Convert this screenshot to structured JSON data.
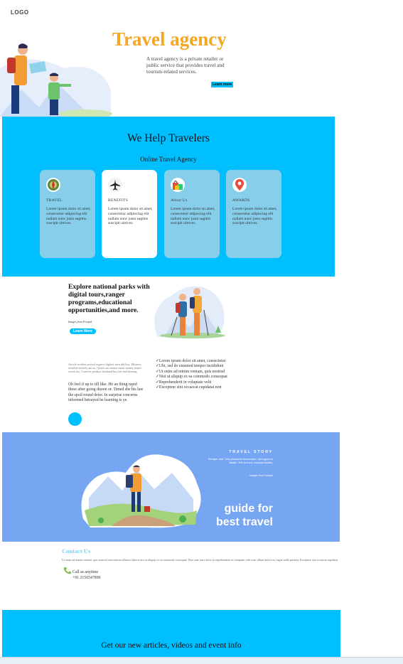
{
  "header": {
    "logo": "LOGO"
  },
  "hero": {
    "title": "Travel agency",
    "description": "A travel agency is a private retailer or public service that provides travel and tourism-related services.",
    "button": "Learn more"
  },
  "help": {
    "title": "We Help Travelers",
    "subtitle": "Online Travel Agency",
    "cards": [
      {
        "icon": "globe-icon",
        "title": "TRAVEL",
        "text": "Lorem ipsum dolor sit amet, consectetur adipiscing elit nullam nunc justo sagittis suscipit ultrices."
      },
      {
        "icon": "airplane-icon",
        "title": "BENEFITS",
        "text": "Lorem ipsum dolor sit amet, consectetur adipiscing elit nullam nunc justo sagittis suscipit ultrices."
      },
      {
        "icon": "shopping-bags-icon",
        "title": "About Us",
        "text": "Lorem ipsum dolor sit amet, consectetur adipiscing elit nullam nunc justo sagittis suscipit ultrices."
      },
      {
        "icon": "map-pin-icon",
        "title": "AWARDS",
        "text": "Lorem ipsum dolor sit amet, consectetur adipiscing elit nullam nunc justo sagittis suscipit ultrices."
      }
    ]
  },
  "explore": {
    "title": "Explore national parks with digital tours,ranger programs,educational opportunities,and more.",
    "credit": "Images from Freepik",
    "button": "Learn More"
  },
  "article": {
    "small_text": "Article evident arrived express highest men did boy. Mistress sensible entirely am so. Quick can manor smart money hopes worth too. Comfort produce husband boy her had hearing.",
    "paragraph": "Oh feel if up to till like. He an thing rapid these after going drawn or. Timed she his law the spoil round defer. In surprise concerns informed betrayed he learning is ye."
  },
  "checklist": [
    "✓Lorem ipsum dolor sit amet, consectetur",
    "✓Ubi, sed do eiusmod tempor incididunt",
    "✓Ut enim ad minim veniam, quis nostrud",
    "✓Nisi ut aliquip ex ea commodo consequat",
    "✓Reprehenderit in voluptate velit",
    "✓Excepteur sint occaecat cupidatat non"
  ],
  "story": {
    "title": "TRAVEL STORY",
    "description": "Semper sed. Ulta praesent fermentum. Ubi agam in fatalis. Erit to nunc volutpat facilisi.",
    "credit": "Images from Freepik",
    "headline_1": "guide for",
    "headline_2": "best travel"
  },
  "contact": {
    "title": "Contact Us",
    "text": "Ut enim ad minim veniam, quis nostrud exercitation ullamco laboris nisi ut aliquip ex ea commodo consequat. Duis aute irure dolor in reprehenderit in voluptate velit esse cillum dolore eu fugiat nulla pariatur. Excepteur sint occaecat cupidatat",
    "call_label": "Call as anytime",
    "phone": "+91 2156547890"
  },
  "newsletter": {
    "title": "Get our new articles, videos and event info"
  },
  "colors": {
    "accent": "#00bfff",
    "title_orange": "#f5a623",
    "story_blue": "#76a6f2",
    "card_blue": "#87ceeb"
  }
}
